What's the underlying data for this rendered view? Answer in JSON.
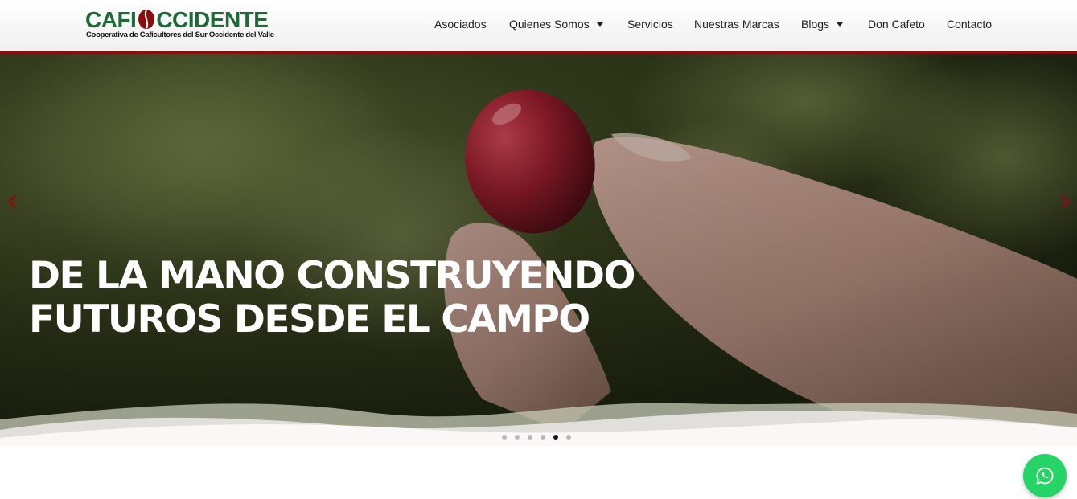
{
  "logo": {
    "main_left": "CAFI",
    "main_right": "CCIDENTE",
    "subtitle": "Cooperativa de Caficultores del Sur Occidente del Valle",
    "brand_green": "#1e6b38",
    "brand_red": "#8b0e0e"
  },
  "nav": {
    "items": [
      {
        "label": "Asociados",
        "dropdown": false
      },
      {
        "label": "Quienes Somos",
        "dropdown": true
      },
      {
        "label": "Servicios",
        "dropdown": false
      },
      {
        "label": "Nuestras Marcas",
        "dropdown": false
      },
      {
        "label": "Blogs",
        "dropdown": true
      },
      {
        "label": "Don Cafeto",
        "dropdown": false
      },
      {
        "label": "Contacto",
        "dropdown": false
      }
    ]
  },
  "hero": {
    "title_line1": "DE LA MANO CONSTRUYENDO",
    "title_line2": "FUTUROS DESDE EL CAMPO",
    "prev_icon": "chevron-left-icon",
    "next_icon": "chevron-right-icon",
    "slide_count": 6,
    "active_slide": 5
  },
  "whatsapp": {
    "icon": "whatsapp-icon",
    "color": "#25d366"
  }
}
